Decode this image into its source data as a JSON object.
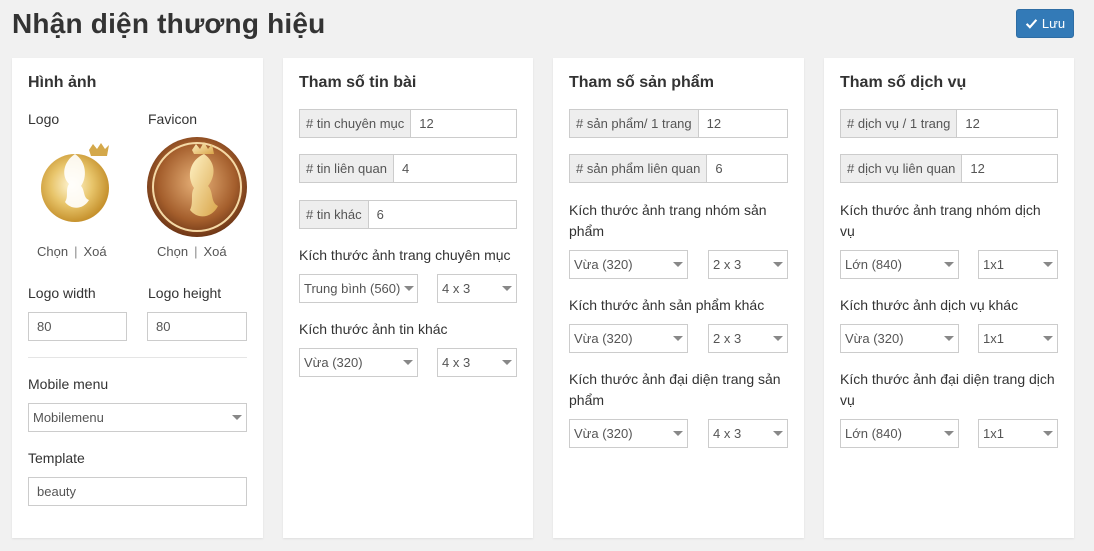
{
  "page": {
    "title": "Nhận diện thương hiệu",
    "save_label": "Lưu"
  },
  "image_card": {
    "title": "Hình ảnh",
    "logo_label": "Logo",
    "favicon_label": "Favicon",
    "choose_label": "Chọn",
    "delete_label": "Xoá",
    "logo_width_label": "Logo width",
    "logo_height_label": "Logo height",
    "logo_width_value": "80",
    "logo_height_value": "80",
    "mobile_menu_label": "Mobile menu",
    "mobile_menu_value": "Mobilemenu",
    "template_label": "Template",
    "template_value": "beauty"
  },
  "news_card": {
    "title": "Tham số tin bài",
    "per_category_label": "# tin chuyên mục",
    "per_category_value": "12",
    "related_label": "# tin liên quan",
    "related_value": "4",
    "other_label": "# tin khác",
    "other_value": "6",
    "category_image_label": "Kích thước ảnh trang chuyên mục",
    "category_image_size": "Trung bình (560)",
    "category_image_grid": "4 x 3",
    "other_image_label": "Kích thước ảnh tin khác",
    "other_image_size": "Vừa (320)",
    "other_image_grid": "4 x 3"
  },
  "product_card": {
    "title": "Tham số sản phẩm",
    "per_page_label": "# sản phẩm/ 1 trang",
    "per_page_value": "12",
    "related_label": "# sản phẩm liên quan",
    "related_value": "6",
    "group_image_label": "Kích thước ảnh trang nhóm sản phẩm",
    "group_image_size": "Vừa (320)",
    "group_image_grid": "2 x 3",
    "other_image_label": "Kích thước ảnh sản phẩm khác",
    "other_image_size": "Vừa (320)",
    "other_image_grid": "2 x 3",
    "featured_image_label": "Kích thước ảnh đại diện trang sản phẩm",
    "featured_image_size": "Vừa (320)",
    "featured_image_grid": "4 x 3"
  },
  "service_card": {
    "title": "Tham số dịch vụ",
    "per_page_label": "# dịch vụ / 1 trang",
    "per_page_value": "12",
    "related_label": "# dịch vụ liên quan",
    "related_value": "12",
    "group_image_label": "Kích thước ảnh trang nhóm dịch vụ",
    "group_image_size": "Lớn (840)",
    "group_image_grid": "1x1",
    "other_image_label": "Kích thước ảnh dịch vụ khác",
    "other_image_size": "Vừa (320)",
    "other_image_grid": "1x1",
    "featured_image_label": "Kích thước ảnh đại diện trang dịch vụ",
    "featured_image_size": "Lớn (840)",
    "featured_image_grid": "1x1"
  },
  "colors": {
    "primary": "#337ab7",
    "gold": "#d4a84a",
    "bronze": "#8a4a22"
  },
  "icons": {
    "save": "check-icon",
    "logo": "woman-crown-logo",
    "favicon": "woman-crown-favicon"
  }
}
